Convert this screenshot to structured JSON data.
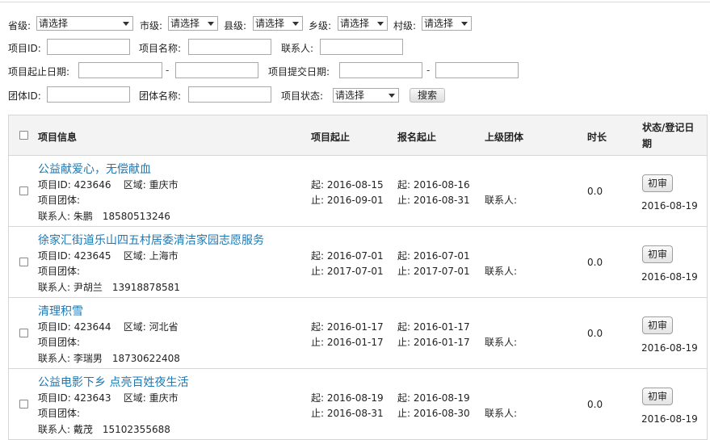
{
  "filters": {
    "province_label": "省级:",
    "city_label": "市级:",
    "county_label": "县级:",
    "town_label": "乡级:",
    "village_label": "村级:",
    "select_placeholder": "请选择",
    "project_id_label": "项目ID:",
    "project_name_label": "项目名称:",
    "contact_label": "联系人:",
    "period_label": "项目起止日期:",
    "submit_date_label": "项目提交日期:",
    "range_sep": "-",
    "group_id_label": "团体ID:",
    "group_name_label": "团体名称:",
    "status_label": "项目状态:",
    "status_value": "请选择",
    "search_button": "搜索"
  },
  "table": {
    "headers": {
      "info": "项目信息",
      "project_period": "项目起止",
      "signup_period": "报名起止",
      "parent_group": "上级团体",
      "duration": "时长",
      "status_line1": "状态/登记日",
      "status_line2": "期"
    },
    "labels": {
      "id": "项目ID:",
      "region": "区域:",
      "group": "项目团体:",
      "contact": "联系人:",
      "start": "起:",
      "end": "止:",
      "parent_contact": "联系人:"
    },
    "rows": [
      {
        "title": "公益献爱心，无偿献血",
        "id": "423646",
        "region": "重庆市",
        "contact": "朱鹏　18580513246",
        "p_start": "2016-08-15",
        "p_end": "2016-09-01",
        "s_start": "2016-08-16",
        "s_end": "2016-08-31",
        "duration": "0.0",
        "action": "初审",
        "date": "2016-08-19"
      },
      {
        "title": "徐家汇街道乐山四五村居委清洁家园志愿服务",
        "id": "423645",
        "region": "上海市",
        "contact": "尹胡兰　13918878581",
        "p_start": "2016-07-01",
        "p_end": "2017-07-01",
        "s_start": "2016-07-01",
        "s_end": "2017-07-01",
        "duration": "0.0",
        "action": "初审",
        "date": "2016-08-19"
      },
      {
        "title": "清理积雪",
        "id": "423644",
        "region": "河北省",
        "contact": "李瑞男　18730622408",
        "p_start": "2016-01-17",
        "p_end": "2016-01-17",
        "s_start": "2016-01-17",
        "s_end": "2016-01-17",
        "duration": "0.0",
        "action": "初审",
        "date": "2016-08-19"
      },
      {
        "title": "公益电影下乡 点亮百姓夜生活",
        "id": "423643",
        "region": "重庆市",
        "contact": "戴茂　15102355688",
        "p_start": "2016-08-19",
        "p_end": "2016-08-31",
        "s_start": "2016-08-19",
        "s_end": "2016-08-30",
        "duration": "0.0",
        "action": "初审",
        "date": "2016-08-19"
      }
    ]
  }
}
